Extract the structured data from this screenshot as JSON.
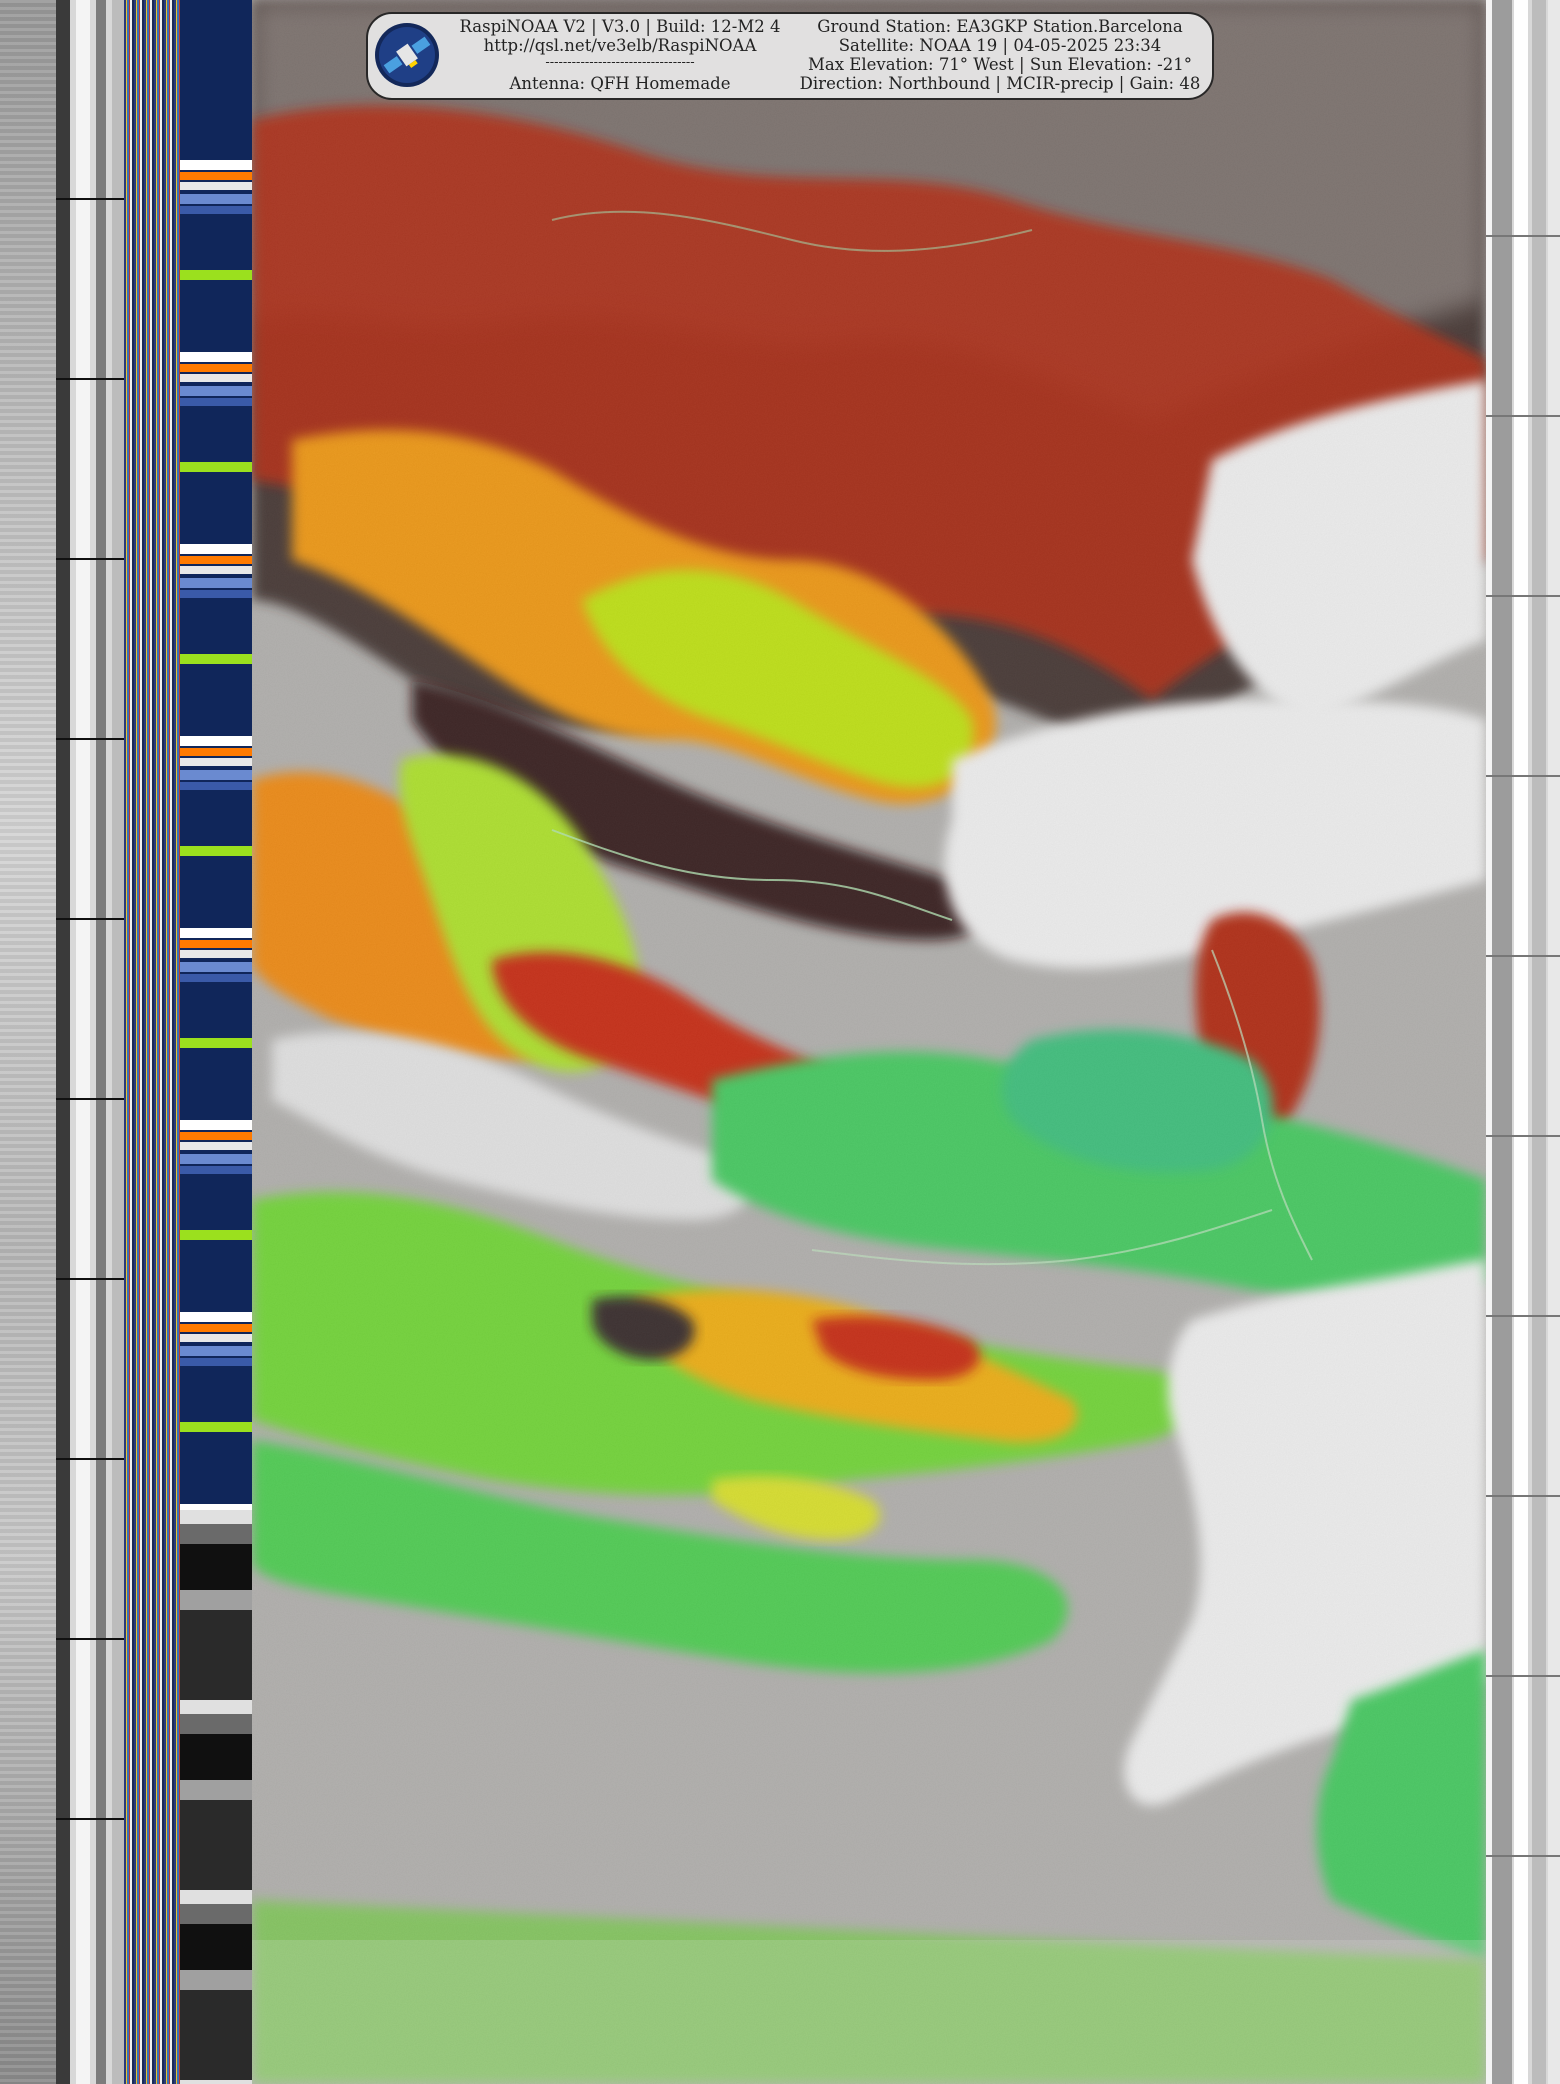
{
  "header": {
    "software_line": "RaspiNOAA V2 | V3.0 | Build: 12-M2 4",
    "url": "http://qsl.net/ve3elb/RaspiNOAA",
    "separator": "----------------------------------",
    "antenna": "Antenna: QFH Homemade",
    "ground_station": "Ground Station: EA3GKP Station.Barcelona",
    "satellite": "Satellite: NOAA 19 | 04-05-2025 23:34",
    "elevation": "Max Elevation: 71° West | Sun Elevation: -21°",
    "direction": "Direction: Northbound | MCIR-precip | Gain: 48"
  },
  "icons": {
    "logo": "satellite-logo-icon"
  },
  "palette": {
    "cloud": "#ffffff",
    "land_gray": "#b8b6b3",
    "precip_green": "#3ad45a",
    "precip_lime": "#b4f01e",
    "precip_yellow": "#ffdc00",
    "precip_orange": "#ff8a00",
    "precip_red": "#d21e00",
    "precip_darkred": "#5a0a00",
    "telemetry_blue": "#10265a"
  }
}
